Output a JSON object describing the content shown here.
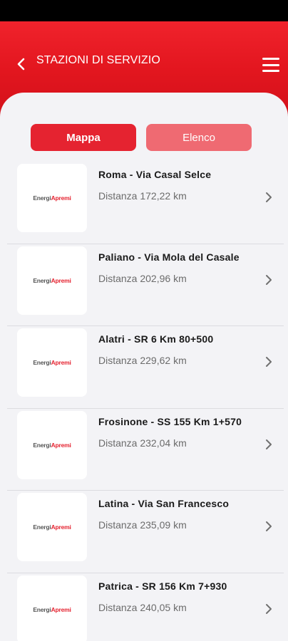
{
  "header": {
    "title": "STAZIONI DI SERVIZIO"
  },
  "segments": {
    "map_label": "Mappa",
    "list_label": "Elenco"
  },
  "logo": {
    "part1": "Energi",
    "part2": "Apremi"
  },
  "stations": [
    {
      "name": "Roma - Via Casal Selce",
      "distance": "Distanza 172,22 km"
    },
    {
      "name": "Paliano - Via Mola del Casale",
      "distance": "Distanza 202,96 km"
    },
    {
      "name": "Alatri - SR 6 Km 80+500",
      "distance": "Distanza 229,62 km"
    },
    {
      "name": "Frosinone - SS 155 Km 1+570",
      "distance": "Distanza 232,04 km"
    },
    {
      "name": "Latina - Via San Francesco",
      "distance": "Distanza 235,09 km"
    },
    {
      "name": "Patrica - SR 156 Km 7+930",
      "distance": "Distanza 240,05 km"
    }
  ],
  "colors": {
    "brand_red": "#e52330",
    "header_red": "#e3161f",
    "segment_inactive": "#ef6a72"
  },
  "icons": {
    "back": "chevron-left-icon",
    "menu": "hamburger-menu-icon",
    "row_arrow": "chevron-right-icon"
  }
}
